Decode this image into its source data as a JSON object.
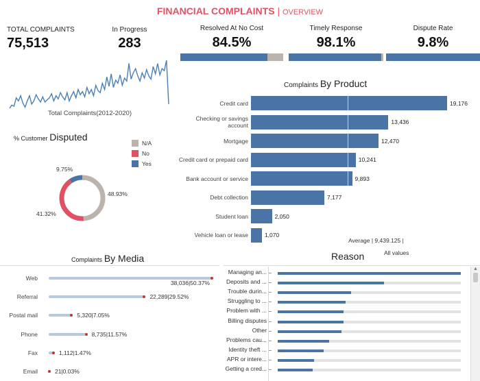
{
  "header": {
    "title": "FINANCIAL COMPLAINTS",
    "separator": "|",
    "subtitle": "OVERVIEW"
  },
  "kpis": {
    "total_complaints": {
      "label": "TOTAL COMPLAINTS",
      "value": "75,513"
    },
    "in_progress": {
      "label": "In Progress",
      "value": "283"
    },
    "resolved": {
      "label": "Resolved At No Cost",
      "value": "84.5%",
      "fraction": 0.845
    },
    "timely": {
      "label": "Timely Response",
      "value": "98.1%",
      "fraction": 0.981
    },
    "dispute": {
      "label": "Dispute Rate",
      "value": "9.8%",
      "fraction": 0.098
    }
  },
  "colors": {
    "blue": "#4a73a6",
    "red": "#e05263",
    "gray": "#bcb3ad",
    "line": "#4a7fb5",
    "track": "#b6c9dd",
    "dot": "#c0392b"
  },
  "trend": {
    "caption": "Total Complaints(2012-2020)",
    "values": [
      2,
      5,
      4,
      12,
      9,
      14,
      7,
      3,
      9,
      14,
      6,
      9,
      15,
      11,
      8,
      13,
      8,
      10,
      12,
      16,
      9,
      14,
      11,
      17,
      13,
      10,
      17,
      9,
      14,
      18,
      12,
      20,
      15,
      18,
      13,
      22,
      16,
      20,
      14,
      24,
      19,
      17,
      26,
      20,
      32,
      23,
      35,
      22,
      29,
      26,
      34,
      24,
      31,
      28,
      45,
      30,
      36,
      40,
      33,
      28,
      36,
      31,
      39,
      33,
      30,
      42,
      35,
      45,
      34,
      40,
      38,
      48,
      6
    ]
  },
  "chart_data": [
    {
      "type": "bar",
      "title": "Complaints By Product",
      "title_prefix": "Complaints",
      "title_main": "By Product",
      "orientation": "horizontal",
      "categories": [
        "Credit card",
        "Checking or savings account",
        "Mortgage",
        "Credit card or prepaid card",
        "Bank account or service",
        "Debt collection",
        "Student loan",
        "Vehicle loan or lease"
      ],
      "category_lines": [
        [
          "Credit card"
        ],
        [
          "Checking or savings",
          "account"
        ],
        [
          "Mortgage"
        ],
        [
          "Credit card or prepaid card"
        ],
        [
          "Bank account or service"
        ],
        [
          "Debt collection"
        ],
        [
          "Student loan"
        ],
        [
          "Vehicle loan or lease"
        ]
      ],
      "values": [
        19176,
        13436,
        12470,
        10241,
        9893,
        7177,
        2050,
        1070
      ],
      "value_labels": [
        "19,176",
        "13,436",
        "12,470",
        "10,241",
        "9,893",
        "7,177",
        "2,050",
        "1,070"
      ],
      "reference_line": {
        "value": 9439.125,
        "label": "Average  |  9,439.125  |",
        "sublabel": "All values"
      },
      "xlim": [
        0,
        19176
      ]
    },
    {
      "type": "pie",
      "title": "% Customer Disputed",
      "title_prefix": "% Customer",
      "title_main": "Disputed",
      "style": "donut",
      "legend_position": "top-right",
      "slices": [
        {
          "name": "N/A",
          "value": 48.93,
          "label": "48.93%",
          "color": "#bcb3ad"
        },
        {
          "name": "No",
          "value": 41.32,
          "label": "41.32%",
          "color": "#e05263"
        },
        {
          "name": "Yes",
          "value": 9.75,
          "label": "9.75%",
          "color": "#4a73a6"
        }
      ]
    },
    {
      "type": "bar",
      "title": "Complaints By Media",
      "title_prefix": "Complaints",
      "title_main": "By Media",
      "orientation": "horizontal",
      "categories": [
        "Web",
        "Referral",
        "Postal mail",
        "Phone",
        "Fax",
        "Email"
      ],
      "values": [
        38036,
        22289,
        5320,
        8735,
        1112,
        21
      ],
      "value_labels": [
        "38,036|50.37%",
        "22,289|29.52%",
        "5,320|7.05%",
        "8,735|11.57%",
        "1,112|1.47%",
        "21|0.03%"
      ],
      "percents": [
        50.37,
        29.52,
        7.05,
        11.57,
        1.47,
        0.03
      ],
      "xlim": [
        0,
        38036
      ]
    },
    {
      "type": "bar",
      "title": "Reason",
      "orientation": "horizontal",
      "categories": [
        "Managing an...",
        "Deposits and ...",
        "Trouble durin...",
        "Struggling to ...",
        "Problem with ...",
        "Billing disputes",
        "Other",
        "Problems cau...",
        "Identity theft ...",
        "APR or intere...",
        "Getting a cred..."
      ],
      "fractions": [
        1.0,
        0.58,
        0.4,
        0.37,
        0.36,
        0.36,
        0.35,
        0.28,
        0.25,
        0.2,
        0.19
      ]
    }
  ]
}
